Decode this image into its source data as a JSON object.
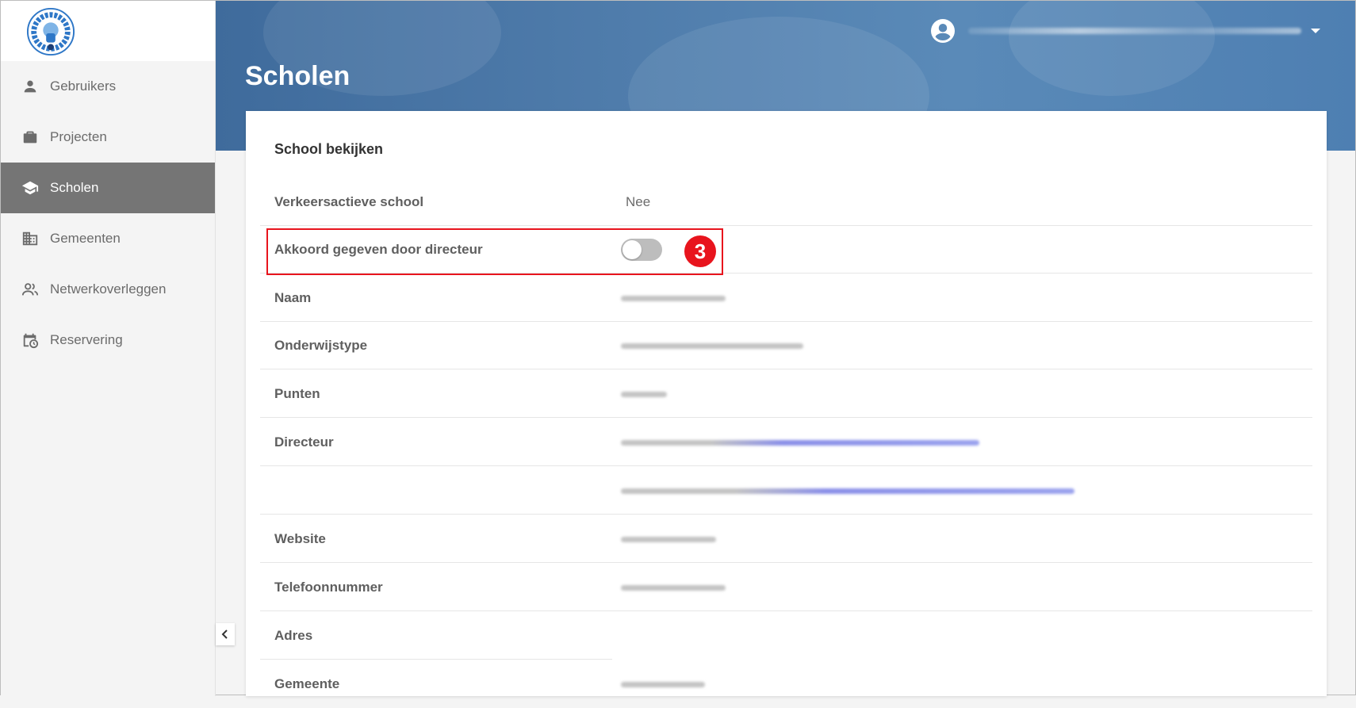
{
  "sidebar": {
    "items": [
      {
        "label": "Gebruikers",
        "icon": "person-icon",
        "active": false
      },
      {
        "label": "Projecten",
        "icon": "briefcase-icon",
        "active": false
      },
      {
        "label": "Scholen",
        "icon": "school-icon",
        "active": true
      },
      {
        "label": "Gemeenten",
        "icon": "building-icon",
        "active": false
      },
      {
        "label": "Netwerkoverleggen",
        "icon": "group-icon",
        "active": false
      },
      {
        "label": "Reservering",
        "icon": "calendar-clock-icon",
        "active": false
      }
    ]
  },
  "header": {
    "title": "Scholen",
    "user_icon": "account-circle-icon"
  },
  "card": {
    "title": "School bekijken",
    "rows": [
      {
        "label": "Verkeersactieve school",
        "value": "Nee"
      },
      {
        "label": "Akkoord gegeven door directeur",
        "toggle_on": false
      },
      {
        "label": "Naam"
      },
      {
        "label": "Onderwijstype"
      },
      {
        "label": "Punten"
      },
      {
        "label": "Directeur"
      },
      {
        "label": ""
      },
      {
        "label": "Website"
      },
      {
        "label": "Telefoonnummer"
      },
      {
        "label": "Adres"
      },
      {
        "label": "Gemeente"
      }
    ]
  },
  "annotation": {
    "step": "3"
  },
  "colors": {
    "highlight": "#e8141d",
    "active_nav": "#757575",
    "header": "#4f7cab"
  }
}
